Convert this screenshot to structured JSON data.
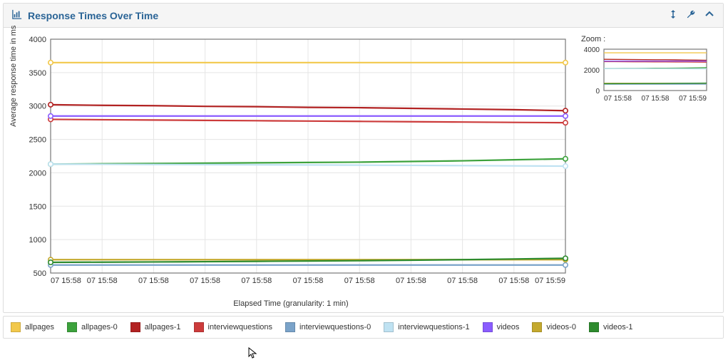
{
  "header": {
    "title": "Response Times Over Time"
  },
  "chart_data": {
    "type": "line",
    "title": "Response Times Over Time",
    "xlabel": "Elapsed Time (granularity: 1 min)",
    "ylabel": "Average response time in ms",
    "ylim": [
      500,
      4000
    ],
    "yticks": [
      500,
      1000,
      1500,
      2000,
      2500,
      3000,
      3500,
      4000
    ],
    "x": [
      "07 15:58",
      "07 15:58",
      "07 15:58",
      "07 15:58",
      "07 15:58",
      "07 15:58",
      "07 15:58",
      "07 15:58",
      "07 15:58",
      "07 15:58",
      "07 15:59"
    ],
    "series": [
      {
        "name": "allpages",
        "color": "#f2c84b",
        "values": [
          3650,
          3650,
          3650,
          3650,
          3650,
          3650,
          3650,
          3650,
          3650,
          3650,
          3650
        ]
      },
      {
        "name": "allpages-0",
        "color": "#3ca23c",
        "values": [
          2130,
          2135,
          2140,
          2145,
          2150,
          2155,
          2160,
          2170,
          2180,
          2195,
          2210
        ]
      },
      {
        "name": "allpages-1",
        "color": "#b22222",
        "values": [
          3020,
          3010,
          3005,
          2995,
          2990,
          2980,
          2975,
          2965,
          2955,
          2945,
          2930
        ]
      },
      {
        "name": "interviewquestions",
        "color": "#cc3b3b",
        "values": [
          2800,
          2795,
          2790,
          2785,
          2780,
          2775,
          2770,
          2765,
          2760,
          2755,
          2750
        ]
      },
      {
        "name": "interviewquestions-0",
        "color": "#7aa3c9",
        "values": [
          620,
          620,
          620,
          620,
          620,
          620,
          620,
          620,
          620,
          620,
          620
        ]
      },
      {
        "name": "interviewquestions-1",
        "color": "#bfe2f2",
        "values": [
          2130,
          2128,
          2125,
          2123,
          2120,
          2118,
          2115,
          2112,
          2108,
          2104,
          2100
        ]
      },
      {
        "name": "videos",
        "color": "#8a5cff",
        "values": [
          2850,
          2850,
          2850,
          2850,
          2850,
          2850,
          2850,
          2850,
          2850,
          2850,
          2850
        ]
      },
      {
        "name": "videos-0",
        "color": "#c4a92e",
        "values": [
          700,
          700,
          700,
          700,
          700,
          700,
          700,
          700,
          700,
          700,
          700
        ]
      },
      {
        "name": "videos-1",
        "color": "#2e8b2e",
        "values": [
          660,
          663,
          666,
          670,
          675,
          680,
          685,
          692,
          700,
          710,
          720
        ]
      }
    ]
  },
  "zoom": {
    "label": "Zoom :",
    "yticks": [
      0,
      2000,
      4000
    ],
    "xticks": [
      "07 15:58",
      "07 15:58",
      "07 15:59"
    ]
  }
}
